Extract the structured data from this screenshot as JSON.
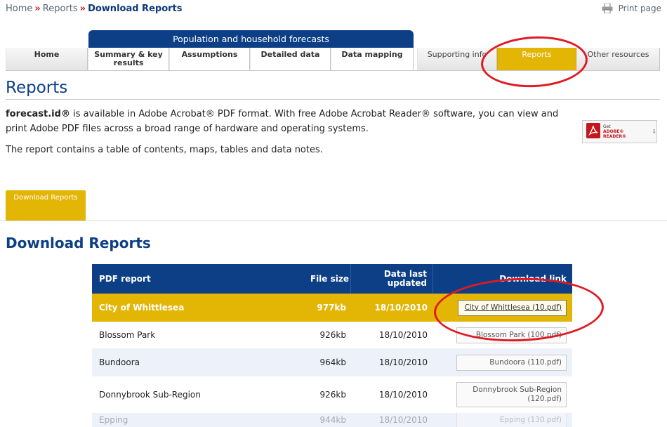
{
  "breadcrumb": {
    "home": "Home",
    "reports": "Reports",
    "current": "Download Reports",
    "separator": "»"
  },
  "print_label": "Print page",
  "banner": "Population and household forecasts",
  "tabs": [
    {
      "label": "Home"
    },
    {
      "label": "Summary & key results"
    },
    {
      "label": "Assumptions"
    },
    {
      "label": "Detailed data"
    },
    {
      "label": "Data mapping"
    },
    {
      "label": "Supporting info"
    },
    {
      "label": "Reports"
    },
    {
      "label": "Other resources"
    }
  ],
  "page_title": "Reports",
  "intro": {
    "brand": "forecast.id®",
    "text1": " is available in Adobe Acrobat® PDF format. With free Adobe Acrobat Reader® software, you can view and print Adobe PDF files across a broad range of hardware and operating systems.",
    "text2": "The report contains a table of contents, maps, tables and data notes."
  },
  "adobe_badge": {
    "line1": "Get",
    "line2": "ADOBE® READER®"
  },
  "subtab": "Download Reports",
  "section_title": "Download Reports",
  "table": {
    "headers": {
      "report": "PDF report",
      "size": "File size",
      "updated": "Data last updated",
      "link": "Download link"
    },
    "rows": [
      {
        "name": "City of Whittlesea",
        "size": "977kb",
        "date": "18/10/2010",
        "link": "City of Whittlesea (10.pdf)"
      },
      {
        "name": "Blossom Park",
        "size": "926kb",
        "date": "18/10/2010",
        "link": "Blossom Park (100.pdf)"
      },
      {
        "name": "Bundoora",
        "size": "964kb",
        "date": "18/10/2010",
        "link": "Bundoora (110.pdf)"
      },
      {
        "name": "Donnybrook Sub-Region",
        "size": "926kb",
        "date": "18/10/2010",
        "link": "Donnybrook Sub-Region (120.pdf)"
      },
      {
        "name": "Epping",
        "size": "944kb",
        "date": "18/10/2010",
        "link": "Epping (130.pdf)"
      }
    ]
  },
  "colors": {
    "navy": "#0c3f86",
    "gold": "#e3b505",
    "annotation_red": "#e01a22"
  }
}
